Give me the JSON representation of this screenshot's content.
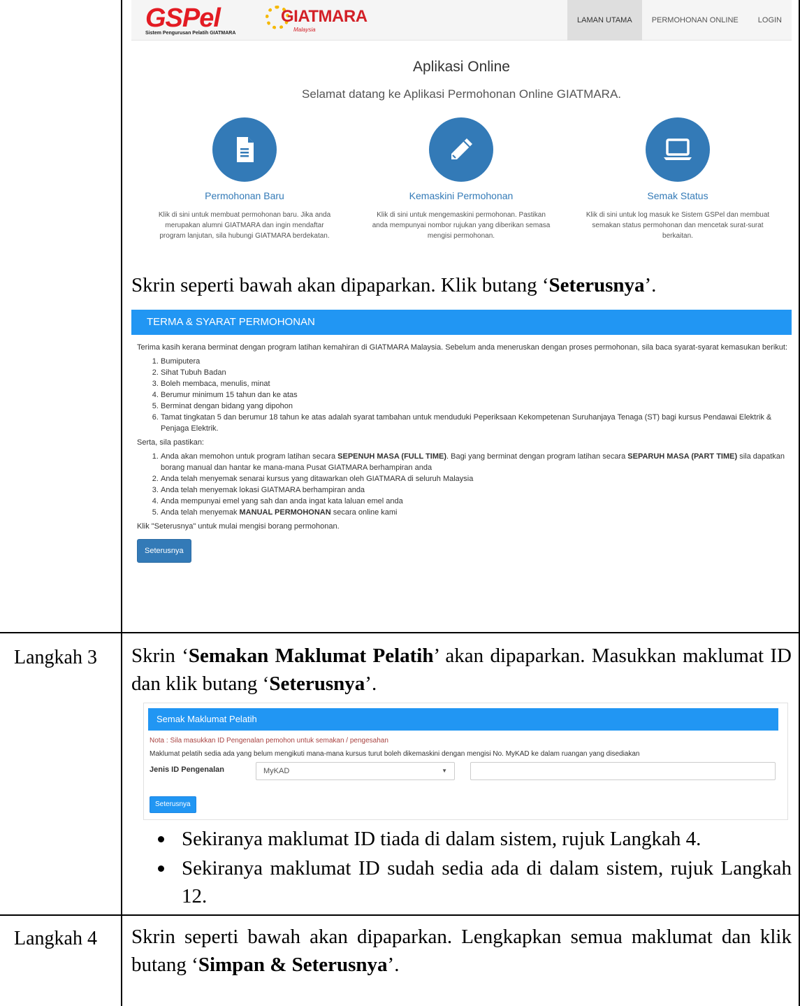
{
  "landing": {
    "logo_gspel": "GSPel",
    "logo_gspel_tagline": "Sistem Pengurusan Pelatih GIATMARA",
    "logo_giatmara": "GIATMARA",
    "logo_giatmara_sub": "Malaysia",
    "nav": [
      "LAMAN UTAMA",
      "PERMOHONAN ONLINE",
      "LOGIN"
    ],
    "title": "Aplikasi Online",
    "subtitle": "Selamat datang ke Aplikasi Permohonan Online GIATMARA.",
    "features": [
      {
        "icon": "document-icon",
        "title": "Permohonan Baru",
        "desc": "Klik di sini untuk membuat permohonan baru. Jika anda merupakan alumni GIATMARA dan ingin mendaftar program lanjutan, sila hubungi GIATMARA berdekatan."
      },
      {
        "icon": "pencil-icon",
        "title": "Kemaskini Permohonan",
        "desc": "Klik di sini untuk mengemaskini permohonan. Pastikan anda mempunyai nombor rujukan yang diberikan semasa mengisi permohonan."
      },
      {
        "icon": "laptop-icon",
        "title": "Semak Status",
        "desc": "Klik di sini untuk log masuk ke Sistem GSPel dan membuat semakan status permohonan dan mencetak surat-surat berkaitan."
      }
    ]
  },
  "doc": {
    "intro_pre": "Skrin seperti bawah akan dipaparkan. Klik butang ‘",
    "intro_bold": "Seterusnya",
    "intro_post": "’.",
    "step3_label": "Langkah 3",
    "step3_pre": "Skrin ‘",
    "step3_bold1": "Semakan Maklumat Pelatih",
    "step3_mid": "’ akan dipaparkan. Masukkan maklumat ID dan klik butang ‘",
    "step3_bold2": "Seterusnya",
    "step3_post": "’.",
    "bullet1": "Sekiranya maklumat ID tiada di dalam sistem, rujuk Langkah 4.",
    "bullet2": "Sekiranya maklumat ID sudah sedia ada di dalam sistem, rujuk Langkah 12.",
    "step4_label": "Langkah 4",
    "step4_pre": "Skrin seperti bawah akan dipaparkan. Lengkapkan semua maklumat dan klik butang ‘",
    "step4_bold": "Simpan & Seterusnya",
    "step4_post": "’."
  },
  "terms": {
    "header": "TERMA & SYARAT PERMOHONAN",
    "intro": "Terima kasih kerana berminat dengan program latihan kemahiran di GIATMARA Malaysia. Sebelum anda meneruskan dengan proses permohonan, sila baca syarat-syarat kemasukan berikut:",
    "requirements": [
      "Bumiputera",
      "Sihat Tubuh Badan",
      "Boleh membaca, menulis, minat",
      "Berumur minimum 15 tahun dan ke atas",
      "Berminat dengan bidang yang dipohon",
      "Tamat tingkatan 5 dan berumur 18 tahun ke atas adalah syarat tambahan untuk menduduki Peperiksaan Kekompetenan Suruhanjaya Tenaga (ST) bagi kursus Pendawai Elektrik & Penjaga Elektrik."
    ],
    "also_label": "Serta, sila pastikan:",
    "confirm1_pre": "Anda akan memohon untuk program latihan secara ",
    "confirm1_bold1": "SEPENUH MASA (FULL TIME)",
    "confirm1_mid": ". Bagi yang berminat dengan program latihan secara ",
    "confirm1_bold2": "SEPARUH MASA (PART TIME)",
    "confirm1_post": " sila dapatkan borang manual dan hantar ke mana-mana Pusat GIATMARA berhampiran anda",
    "confirm2": "Anda telah menyemak senarai kursus yang ditawarkan oleh GIATMARA di seluruh Malaysia",
    "confirm3": "Anda telah menyemak lokasi GIATMARA berhampiran anda",
    "confirm4": "Anda mempunyai emel yang sah dan anda ingat kata laluan emel anda",
    "confirm5_pre": "Anda telah menyemak ",
    "confirm5_bold": "MANUAL PERMOHONAN",
    "confirm5_post": " secara online kami",
    "footer": "Klik \"Seterusnya\" untuk mulai mengisi borang permohonan.",
    "button": "Seterusnya"
  },
  "semak": {
    "header": "Semak Maklumat Pelatih",
    "note": "Nota : Sila masukkan ID Pengenalan pemohon untuk semakan / pengesahan",
    "info": "Maklumat pelatih sedia ada yang belum mengikuti mana-mana kursus turut boleh dikemaskini dengan mengisi No. MyKAD ke dalam ruangan yang disediakan",
    "id_label": "Jenis ID Pengenalan",
    "id_type": "MyKAD",
    "id_value": "",
    "button": "Seterusnya"
  }
}
